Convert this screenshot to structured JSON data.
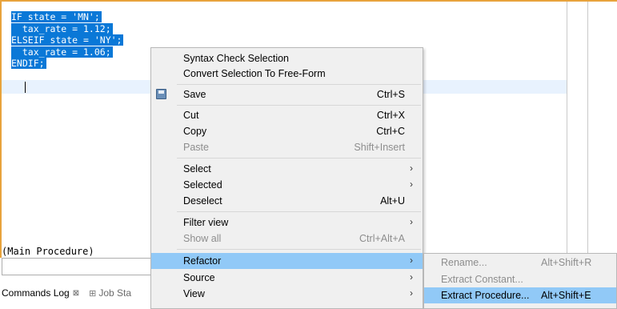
{
  "code_lines": [
    "IF state = 'MN';",
    "  tax_rate = 1.12;",
    "ELSEIF state = 'NY';",
    "  tax_rate = 1.06;",
    "ENDIF;"
  ],
  "main_procedure_label": "(Main Procedure)",
  "tabs": [
    {
      "label": "Commands Log",
      "close": "⊠"
    },
    {
      "label": "Job Sta"
    }
  ],
  "context_menu": {
    "items": {
      "syntax_check": {
        "label": "Syntax Check Selection"
      },
      "convert_free_form": {
        "label": "Convert Selection To Free-Form"
      },
      "save": {
        "label": "Save",
        "accel": "Ctrl+S"
      },
      "cut": {
        "label": "Cut",
        "accel": "Ctrl+X"
      },
      "copy": {
        "label": "Copy",
        "accel": "Ctrl+C"
      },
      "paste": {
        "label": "Paste",
        "accel": "Shift+Insert"
      },
      "select": {
        "label": "Select"
      },
      "selected": {
        "label": "Selected"
      },
      "deselect": {
        "label": "Deselect",
        "accel": "Alt+U"
      },
      "filter_view": {
        "label": "Filter view"
      },
      "show_all": {
        "label": "Show all",
        "accel": "Ctrl+Alt+A"
      },
      "refactor": {
        "label": "Refactor"
      },
      "source": {
        "label": "Source"
      },
      "view": {
        "label": "View"
      }
    }
  },
  "refactor_submenu": {
    "rename": {
      "label": "Rename...",
      "accel": "Alt+Shift+R"
    },
    "extract_constant": {
      "label": "Extract Constant..."
    },
    "extract_procedure": {
      "label": "Extract Procedure...",
      "accel": "Alt+Shift+E"
    }
  },
  "icons": {
    "save": "save-icon",
    "submenu_arrow": "›"
  },
  "colors": {
    "selection": "#0a78d7",
    "menu_highlight": "#91c9f7",
    "editor_border": "#e8a33c"
  }
}
